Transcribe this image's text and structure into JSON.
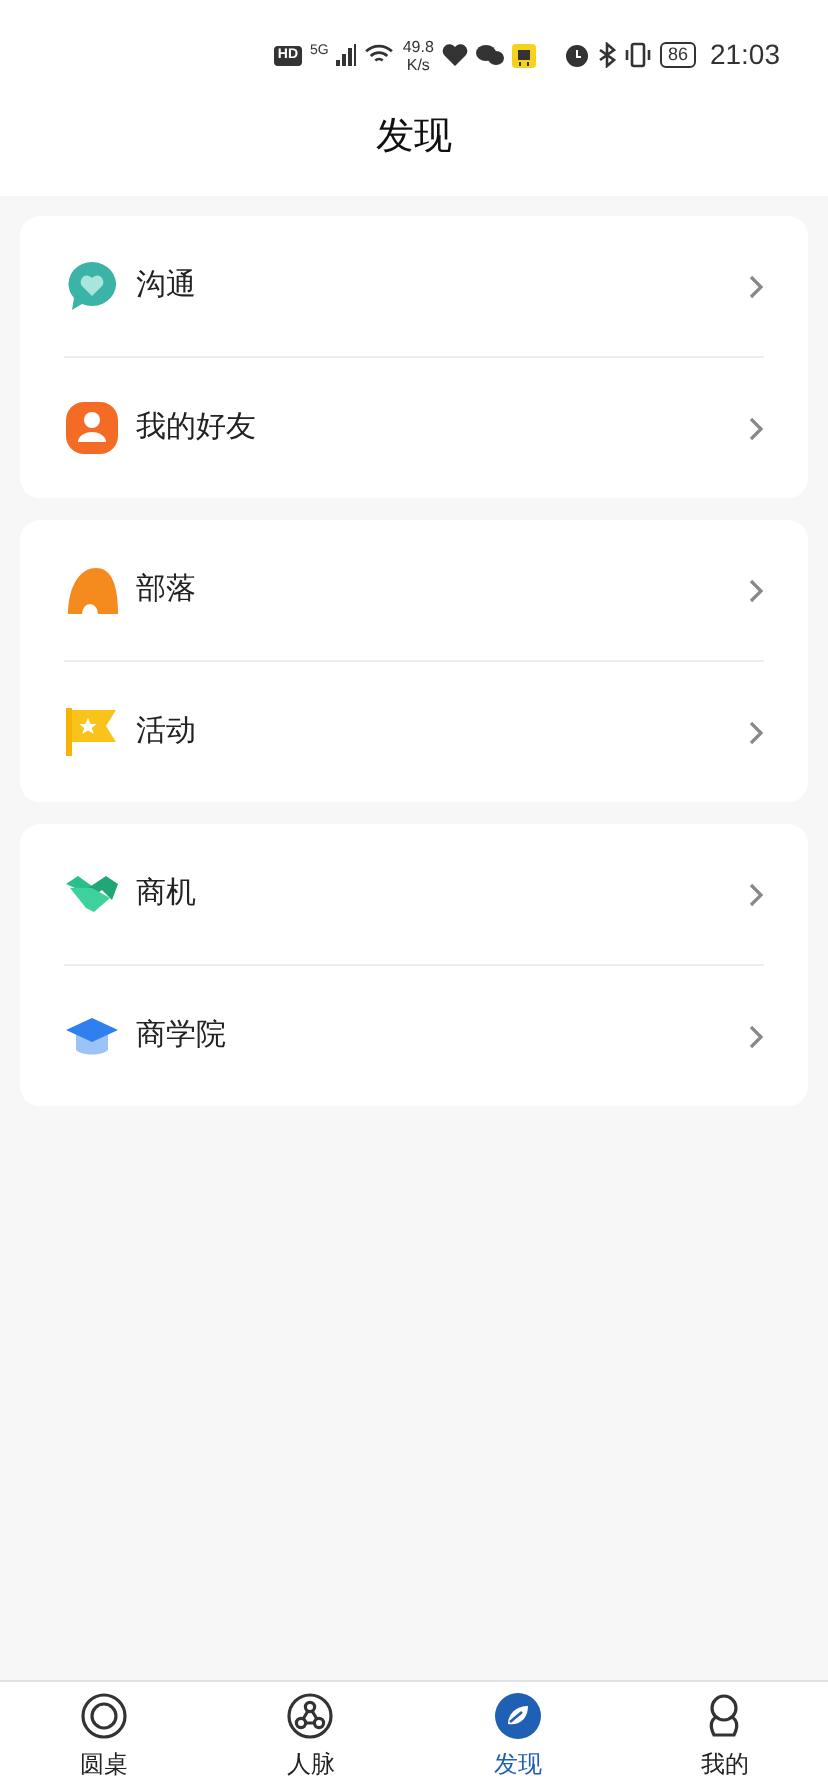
{
  "status_bar": {
    "hd": "HD",
    "network": "5G",
    "speed_value": "49.8",
    "speed_unit": "K/s",
    "battery": "86",
    "time": "21:03"
  },
  "header": {
    "title": "发现"
  },
  "groups": [
    {
      "items": [
        {
          "kind": "chat",
          "label": "沟通"
        },
        {
          "kind": "friends",
          "label": "我的好友"
        }
      ]
    },
    {
      "items": [
        {
          "kind": "tribe",
          "label": "部落"
        },
        {
          "kind": "event",
          "label": "活动"
        }
      ]
    },
    {
      "items": [
        {
          "kind": "business",
          "label": "商机"
        },
        {
          "kind": "school",
          "label": "商学院"
        }
      ]
    }
  ],
  "tab_bar": [
    {
      "kind": "roundtable",
      "label": "圆桌",
      "selected": false
    },
    {
      "kind": "network",
      "label": "人脉",
      "selected": false
    },
    {
      "kind": "discover",
      "label": "发现",
      "selected": true
    },
    {
      "kind": "me",
      "label": "我的",
      "selected": false
    }
  ]
}
